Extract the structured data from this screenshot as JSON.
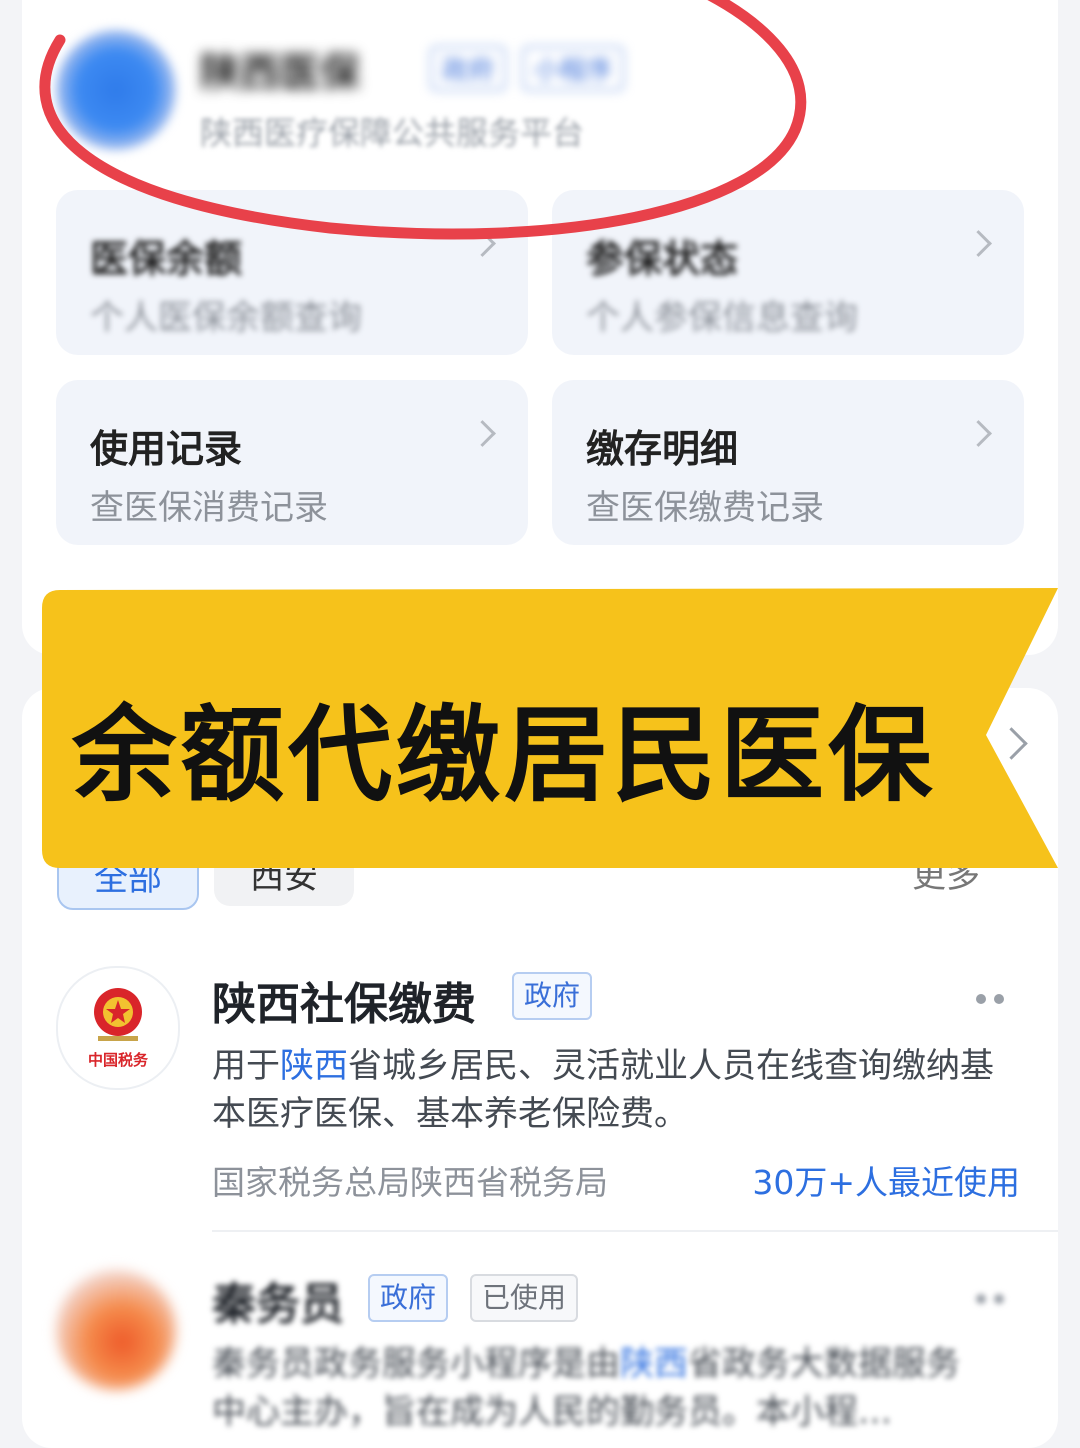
{
  "header": {
    "app_name": "陕西医保",
    "tags": [
      "政府",
      "小程序"
    ],
    "subtitle": "陕西医疗保障公共服务平台"
  },
  "tiles": [
    {
      "title": "医保余额",
      "subtitle": "个人医保余额查询"
    },
    {
      "title": "参保状态",
      "subtitle": "个人参保信息查询"
    },
    {
      "title": "使用记录",
      "subtitle": "查医保消费记录"
    },
    {
      "title": "缴存明细",
      "subtitle": "查医保缴费记录"
    }
  ],
  "banner": {
    "text": "余额代缴居民医保",
    "color": "#f6c21b"
  },
  "filters": {
    "chips": [
      "全部",
      "西安"
    ],
    "more_label": "更多"
  },
  "results": [
    {
      "title": "陕西社保缴费",
      "tags": [
        "政府"
      ],
      "desc_before": "用于",
      "desc_highlight": "陕西",
      "desc_after": "省城乡居民、灵活就业人员在线查询缴纳基本医疗医保、基本养老保险费。",
      "org": "国家税务总局陕西省税务局",
      "usage": "30万+人最近使用",
      "logo_text": "中国税务"
    },
    {
      "title": "秦务员",
      "tags": [
        "政府",
        "已使用"
      ],
      "desc_before": "秦务员政务服务小程序是由",
      "desc_highlight": "陕西",
      "desc_after": "省政务大数据服务中心主办，旨在成为人民的勤务员。本小程…"
    }
  ],
  "colors": {
    "accent": "#2d6fe0",
    "annotation": "#e8414a",
    "banner": "#f6c21b"
  }
}
